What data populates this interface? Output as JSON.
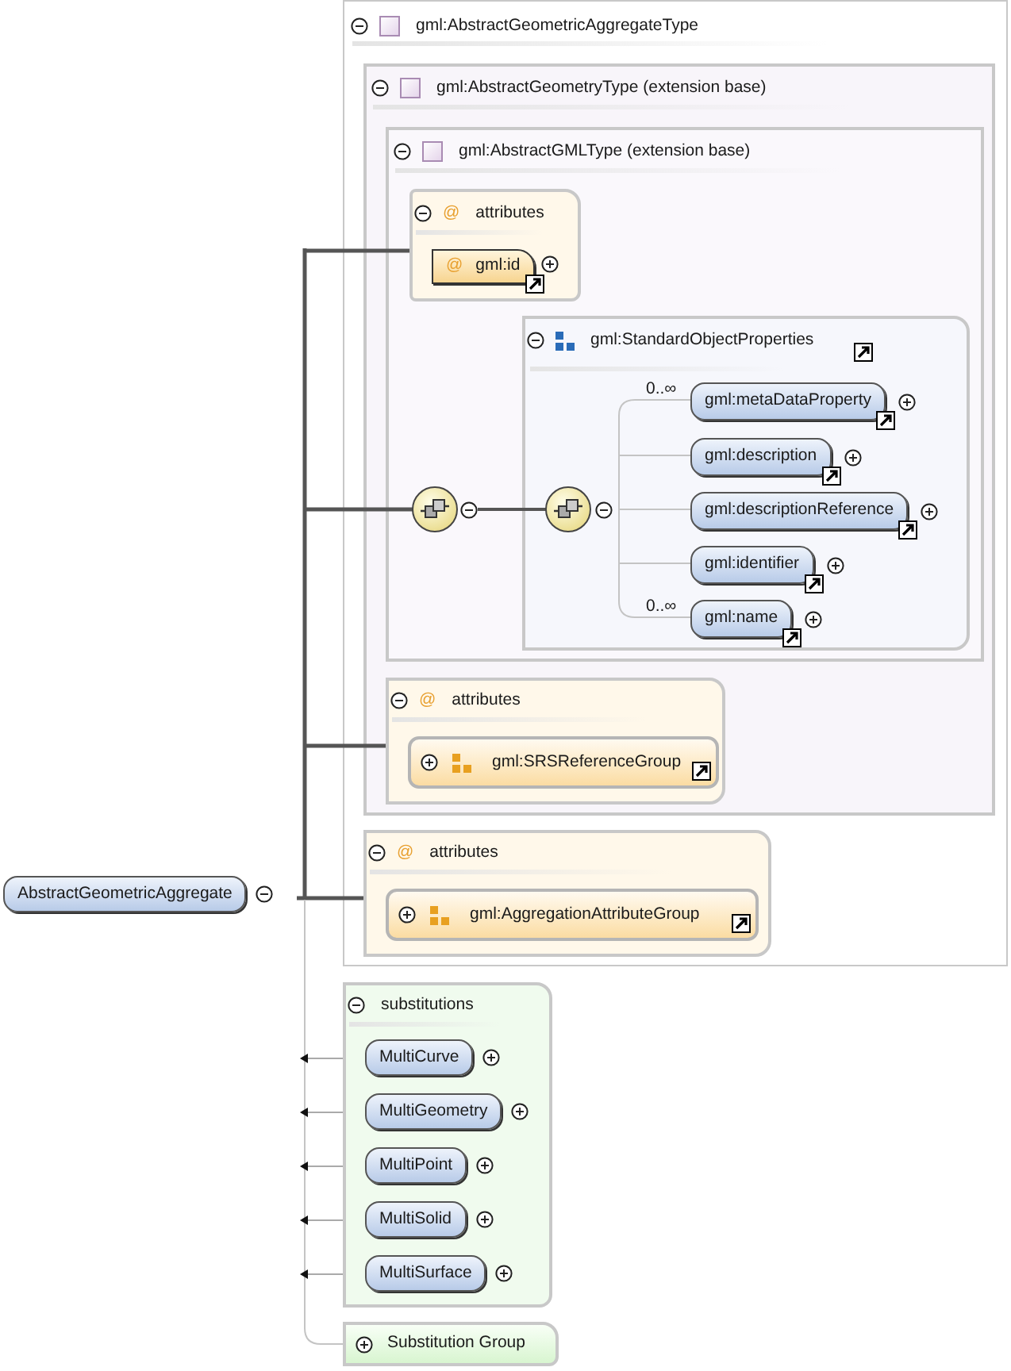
{
  "root_element": {
    "name": "AbstractGeometricAggregate",
    "expanded": true
  },
  "type": {
    "name": "gml:AbstractGeometricAggregateType",
    "expanded": true,
    "base": {
      "name": "gml:AbstractGeometryType (extension base)",
      "expanded": true,
      "base": {
        "name": "gml:AbstractGMLType (extension base)",
        "expanded": true,
        "attributes": {
          "marker": "@",
          "label": "attributes",
          "expanded": true,
          "items": [
            {
              "marker": "@",
              "name": "gml:id",
              "expanded": false
            }
          ]
        },
        "sequence": {
          "expanded": true,
          "inner_sequence": {
            "expanded": true
          },
          "group": {
            "name": "gml:StandardObjectProperties",
            "expanded": true,
            "elements": [
              {
                "occurs": "0..∞",
                "name": "gml:metaDataProperty",
                "expanded": false
              },
              {
                "name": "gml:description",
                "expanded": false
              },
              {
                "name": "gml:descriptionReference",
                "expanded": false
              },
              {
                "name": "gml:identifier",
                "expanded": false
              },
              {
                "occurs": "0..∞",
                "name": "gml:name",
                "expanded": false
              }
            ]
          }
        }
      },
      "attributes": {
        "marker": "@",
        "label": "attributes",
        "expanded": true,
        "items": [
          {
            "name": "gml:SRSReferenceGroup",
            "expanded": false
          }
        ]
      }
    },
    "attributes": {
      "marker": "@",
      "label": "attributes",
      "expanded": true,
      "items": [
        {
          "name": "gml:AggregationAttributeGroup",
          "expanded": false
        }
      ]
    }
  },
  "substitutions": {
    "label": "substitutions",
    "expanded": true,
    "items": [
      {
        "name": "MultiCurve",
        "expanded": false
      },
      {
        "name": "MultiGeometry",
        "expanded": false
      },
      {
        "name": "MultiPoint",
        "expanded": false
      },
      {
        "name": "MultiSolid",
        "expanded": false
      },
      {
        "name": "MultiSurface",
        "expanded": false
      }
    ]
  },
  "substitution_group": {
    "label": "Substitution Group",
    "expanded": false
  }
}
